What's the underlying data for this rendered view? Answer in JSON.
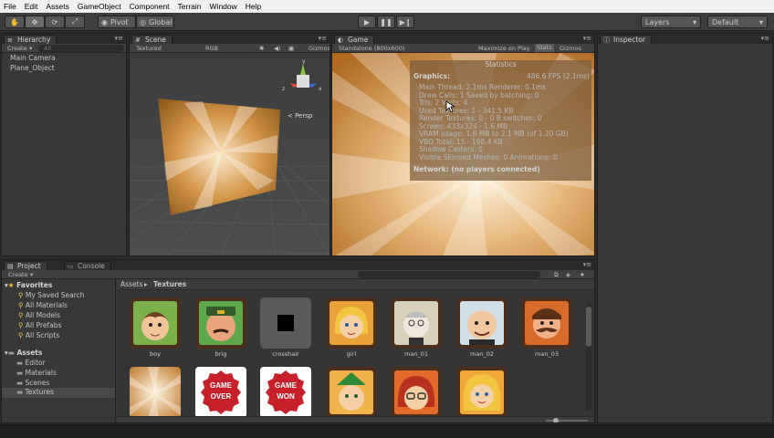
{
  "menu": [
    "File",
    "Edit",
    "Assets",
    "GameObject",
    "Component",
    "Terrain",
    "Window",
    "Help"
  ],
  "toolbar": {
    "pivot": "Pivot",
    "global": "Global",
    "layers": "Layers",
    "layout": "Default"
  },
  "hierarchy": {
    "tab": "Hierarchy",
    "create": "Create",
    "search": "All",
    "items": [
      "Main Camera",
      "Plane_Object"
    ]
  },
  "scene": {
    "tab": "Scene",
    "shading": "Textured",
    "render": "RGB",
    "gizmos": "Gizmos",
    "persp": "< Persp"
  },
  "game": {
    "tab": "Game",
    "aspect": "Standalone (800x600)",
    "maximize": "Maximize on Play",
    "stats": "Stats",
    "gizmos": "Gizmos"
  },
  "stats": {
    "title": "Statistics",
    "graphics_label": "Graphics:",
    "fps": "486.6 FPS (2.1ms)",
    "lines": [
      "Main Thread: 2.1ms  Renderer: 0.1ms",
      "Draw Calls: 1   Saved by batching: 0",
      "Tris: 2    Verts: 4",
      "Used Textures: 1 - 341.5 KB",
      "Render Textures: 0 - 0 B   switches: 0",
      "Screen: 433x324 - 1.6 MB",
      "VRAM usage: 1.6 MB to 2.1 MB (of 1.20 GB)",
      "VBO Total: 15 - 198.4 KB",
      "Shadow Casters: 0",
      "Visible Skinned Meshes: 0     Animations: 0"
    ],
    "network": "Network: (no players connected)"
  },
  "inspector": {
    "tab": "Inspector"
  },
  "project": {
    "tab": "Project",
    "console_tab": "Console",
    "create": "Create",
    "favorites_label": "Favorites",
    "favorites": [
      "My Saved Search",
      "All Materials",
      "All Models",
      "All Prefabs",
      "All Scripts"
    ],
    "assets_label": "Assets",
    "folders": [
      "Editor",
      "Materials",
      "Scenes",
      "Textures"
    ],
    "breadcrumb_root": "Assets",
    "breadcrumb_sep": "▸",
    "breadcrumb_current": "Textures",
    "row1": [
      "boy",
      "brig",
      "crosshair",
      "girl",
      "man_01",
      "man_02",
      "man_03"
    ],
    "gameover": [
      "GAME",
      "OVER"
    ],
    "gamewon": [
      "GAME",
      "WON"
    ]
  }
}
